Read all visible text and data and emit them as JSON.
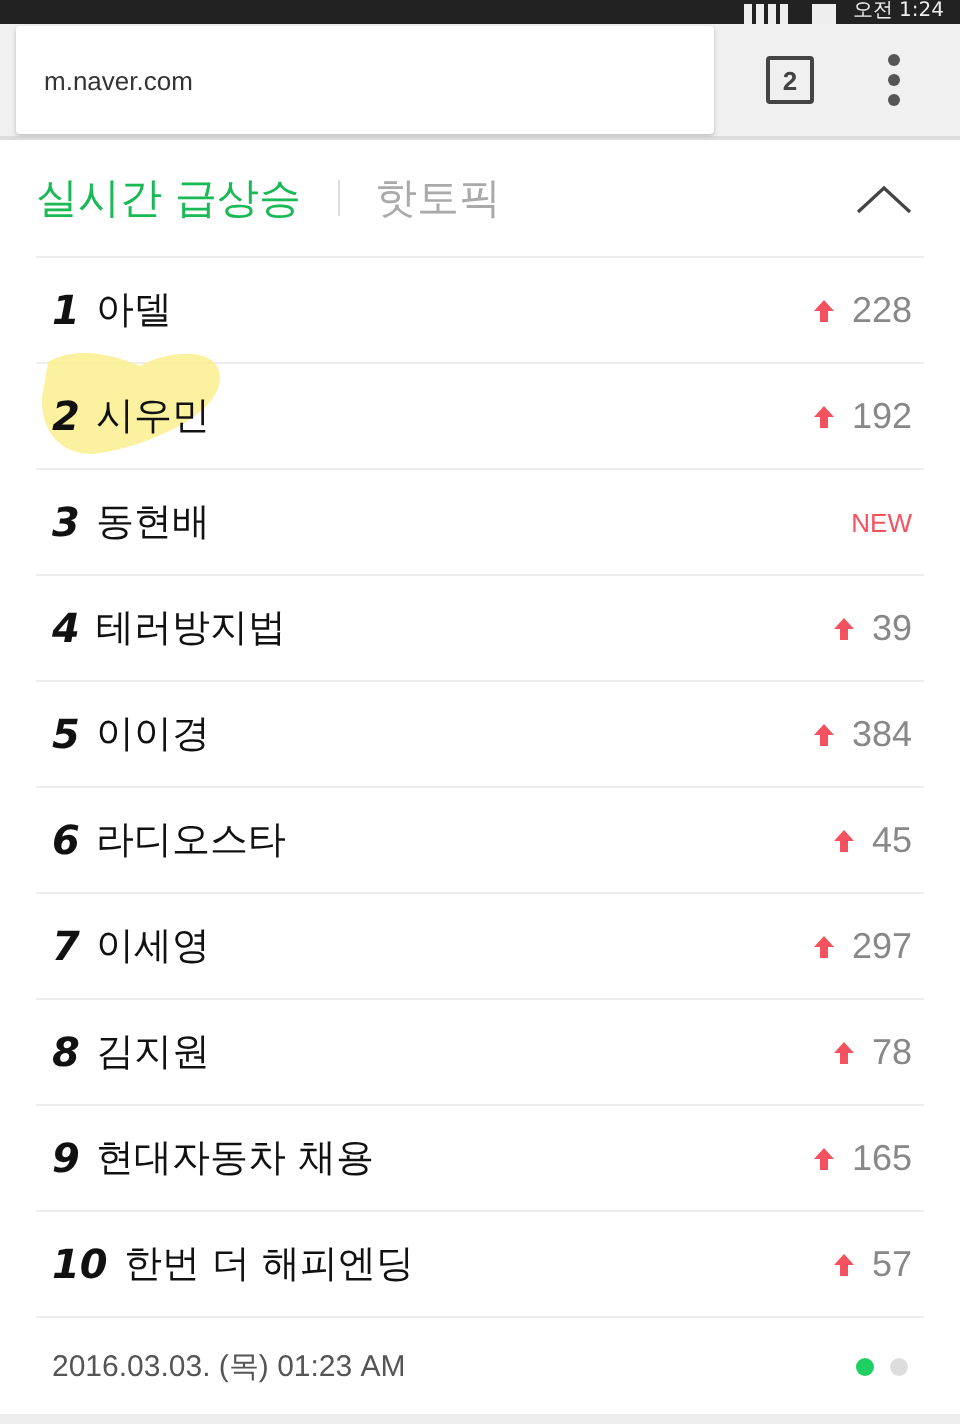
{
  "status_bar": {
    "time": "오전 1:24"
  },
  "browser": {
    "url": "m.naver.com",
    "tab_count": "2"
  },
  "tabs": [
    {
      "label": "실시간 급상승",
      "selected": true
    },
    {
      "label": "핫토픽",
      "selected": false
    }
  ],
  "rankings": [
    {
      "rank": "1",
      "keyword": "아델",
      "kind": "up",
      "change": "228",
      "highlighted": false
    },
    {
      "rank": "2",
      "keyword": "시우민",
      "kind": "up",
      "change": "192",
      "highlighted": true
    },
    {
      "rank": "3",
      "keyword": "동현배",
      "kind": "new",
      "change": "NEW",
      "highlighted": false
    },
    {
      "rank": "4",
      "keyword": "테러방지법",
      "kind": "up",
      "change": "39",
      "highlighted": false
    },
    {
      "rank": "5",
      "keyword": "이이경",
      "kind": "up",
      "change": "384",
      "highlighted": false
    },
    {
      "rank": "6",
      "keyword": "라디오스타",
      "kind": "up",
      "change": "45",
      "highlighted": false
    },
    {
      "rank": "7",
      "keyword": "이세영",
      "kind": "up",
      "change": "297",
      "highlighted": false
    },
    {
      "rank": "8",
      "keyword": "김지원",
      "kind": "up",
      "change": "78",
      "highlighted": false
    },
    {
      "rank": "9",
      "keyword": "현대자동차 채용",
      "kind": "up",
      "change": "165",
      "highlighted": false
    },
    {
      "rank": "10",
      "keyword": "한번 더 해피엔딩",
      "kind": "up",
      "change": "57",
      "highlighted": false
    }
  ],
  "footer": {
    "timestamp": "2016.03.03. (목) 01:23 AM"
  },
  "pages": [
    {
      "selected": true
    },
    {
      "selected": false
    }
  ]
}
